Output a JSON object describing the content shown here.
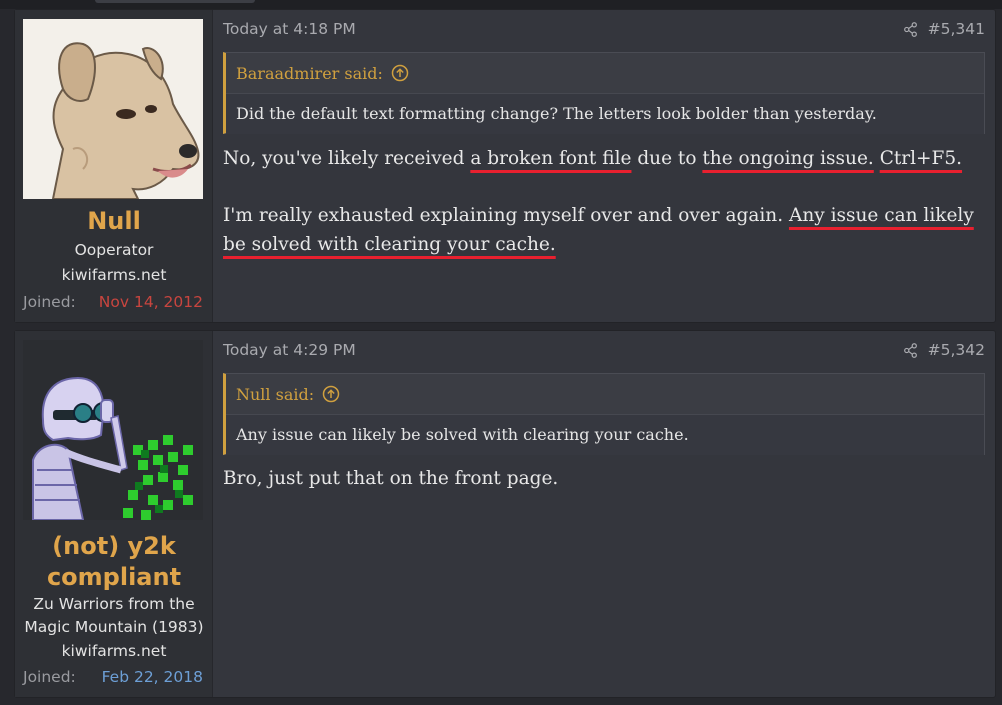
{
  "posts": [
    {
      "author": {
        "name": "Null",
        "title": "Ooperator",
        "site": "kiwifarms.net",
        "joined_label": "Joined:",
        "joined_date": "Nov 14, 2012",
        "avatar_icon": "dog-avatar",
        "joined_color": "#c8453f"
      },
      "time": "Today at 4:18 PM",
      "post_number": "#5,341",
      "quote": {
        "author": "Baraadmirer said:",
        "text": "Did the default text formatting change? The letters look bolder than yesterday."
      },
      "message": {
        "p1_a": "No, you've likely received ",
        "p1_b": "a broken font file",
        "p1_c": " due to ",
        "p1_d": "the ongoing issue.",
        "p1_e": " ",
        "p1_f": "Ctrl+F5.",
        "p2_a": "I'm really exhausted explaining myself over and over again. ",
        "p2_b": "Any issue can likely be solved with clearing your cache."
      }
    },
    {
      "author": {
        "name": "(not) y2k compliant",
        "title": "Zu Warriors from the Magic Mountain (1983)",
        "site": "kiwifarms.net",
        "joined_label": "Joined:",
        "joined_date": "Feb 22, 2018",
        "avatar_icon": "skeleton-binoculars-avatar",
        "joined_color": "#6d9fd6"
      },
      "time": "Today at 4:29 PM",
      "post_number": "#5,342",
      "quote": {
        "author": "Null said:",
        "text": "Any issue can likely be solved with clearing your cache."
      },
      "message": {
        "text": "Bro, just put that on the front page."
      }
    }
  ],
  "colors": {
    "username": "#e0a54b",
    "quote_accent": "#d0a03f",
    "underline": "#e8202f",
    "background": "#27282d",
    "post_bg": "#34363d"
  }
}
